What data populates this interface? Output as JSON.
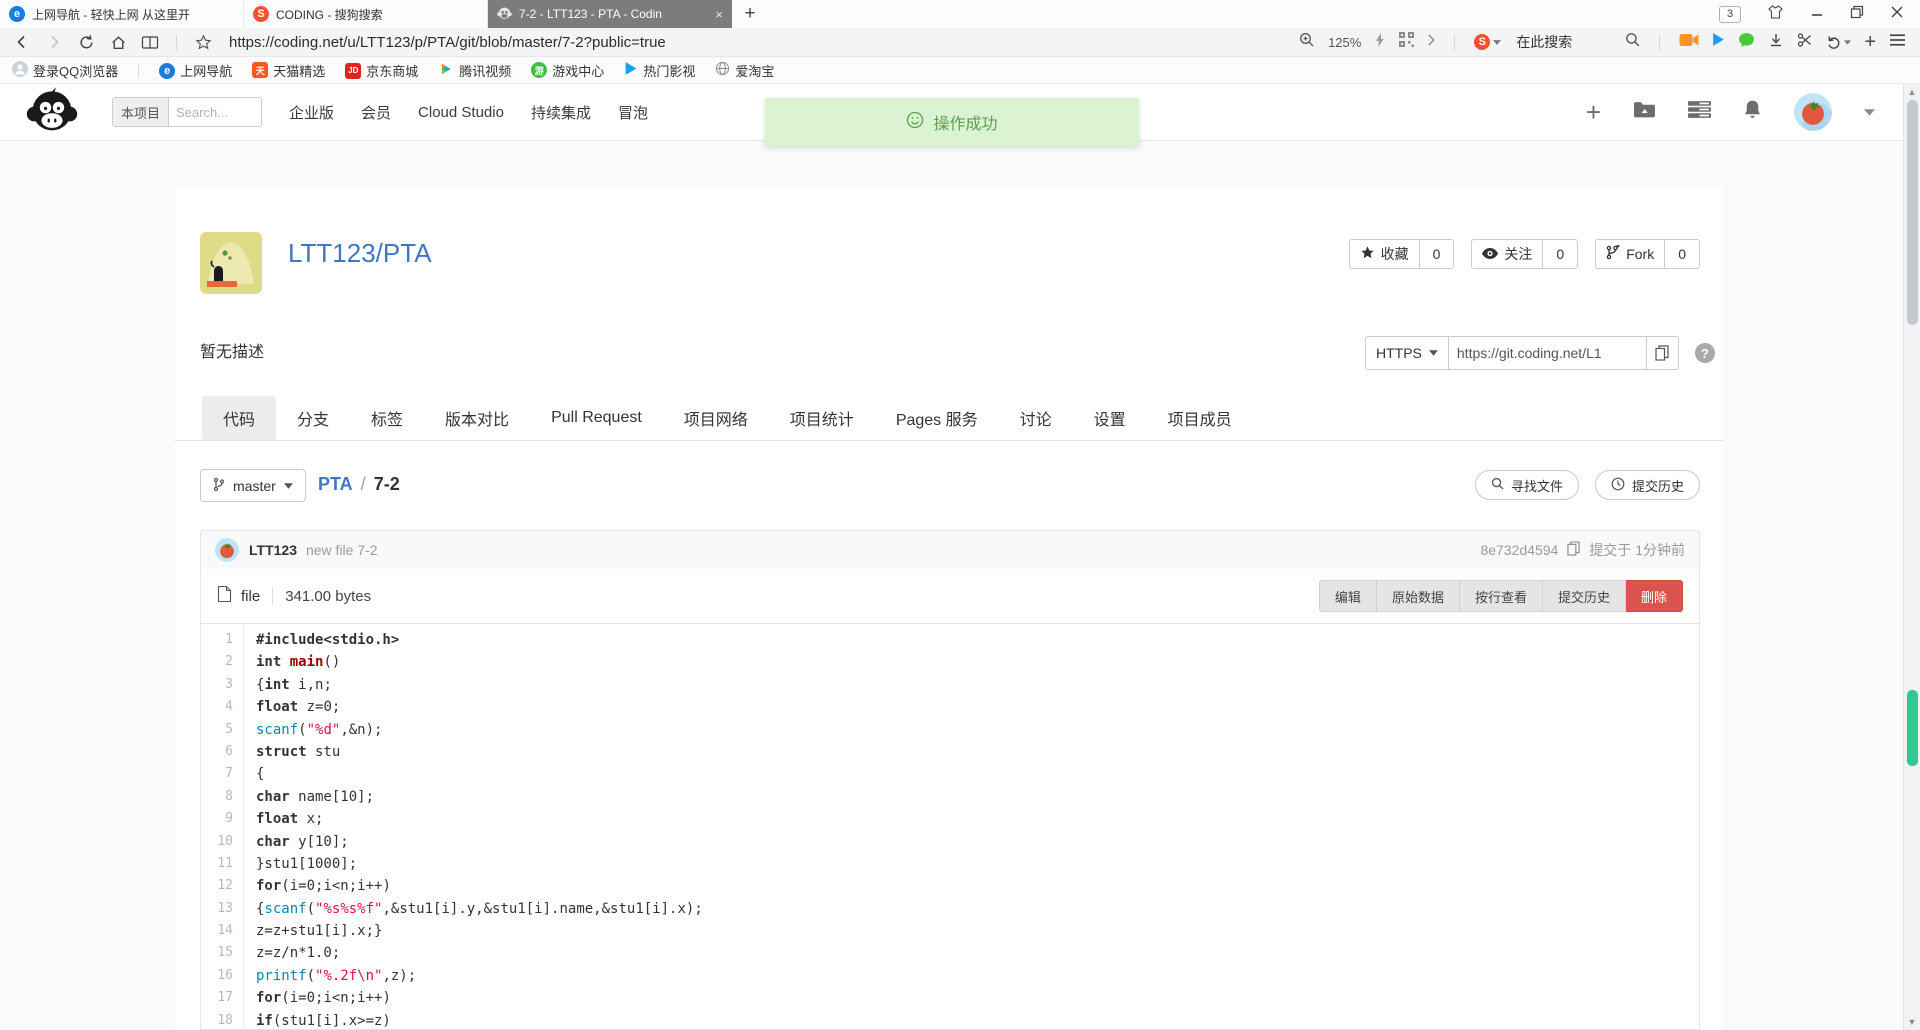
{
  "colors": {
    "accent": "#4078c0",
    "danger": "#d9534f",
    "toast_green": "#58a04e",
    "scroll_marker_green": "#2fc98f"
  },
  "browser": {
    "window": {
      "tab_count": "3"
    },
    "tabs": [
      {
        "title": "上网导航 - 轻快上网 从这里开",
        "icon": "nav-e-icon",
        "active": false
      },
      {
        "title": "CODING - 搜狗搜索",
        "icon": "sogou-icon",
        "active": false
      },
      {
        "title": "7-2 - LTT123 - PTA - Codin",
        "icon": "coding-monkey-icon",
        "active": true
      }
    ],
    "address": {
      "url": "https://coding.net/u/LTT123/p/PTA/git/blob/master/7-2?public=true",
      "zoom": "125%",
      "search_hint": "在此搜索"
    },
    "bookmarks": [
      {
        "label": "登录QQ浏览器",
        "icon": "user-icon"
      },
      {
        "label": "上网导航",
        "icon": "nav-e-icon"
      },
      {
        "label": "天猫精选",
        "icon": "tmall-icon"
      },
      {
        "label": "京东商城",
        "icon": "jd-icon"
      },
      {
        "label": "腾讯视频",
        "icon": "tencent-video-icon"
      },
      {
        "label": "游戏中心",
        "icon": "game-icon"
      },
      {
        "label": "热门影视",
        "icon": "hot-video-icon"
      },
      {
        "label": "爱淘宝",
        "icon": "globe-icon"
      }
    ]
  },
  "site_header": {
    "search_scope": "本项目",
    "search_placeholder": "Search...",
    "nav": [
      "企业版",
      "会员",
      "Cloud Studio",
      "持续集成",
      "冒泡"
    ],
    "toast_text": "操作成功"
  },
  "project": {
    "title": "LTT123/PTA",
    "description": "暂无描述",
    "stats": [
      {
        "label": "收藏",
        "count": "0",
        "icon": "star-icon"
      },
      {
        "label": "关注",
        "count": "0",
        "icon": "eye-icon"
      },
      {
        "label": "Fork",
        "count": "0",
        "icon": "fork-icon"
      }
    ],
    "clone": {
      "protocol": "HTTPS",
      "url": "https://git.coding.net/L1"
    }
  },
  "repo": {
    "tabs": [
      "代码",
      "分支",
      "标签",
      "版本对比",
      "Pull Request",
      "项目网络",
      "项目统计",
      "Pages 服务",
      "讨论",
      "设置",
      "项目成员"
    ],
    "active_tab": "代码",
    "branch": "master",
    "crumbs": [
      "PTA",
      "7-2"
    ],
    "find_file_label": "寻找文件",
    "commit_history_label": "提交历史"
  },
  "commit": {
    "author": "LTT123",
    "message": "new file 7-2",
    "hash": "8e732d4594",
    "time": "提交于 1分钟前"
  },
  "file": {
    "type_label": "file",
    "size": "341.00 bytes",
    "actions": [
      "编辑",
      "原始数据",
      "按行查看",
      "提交历史"
    ],
    "delete_label": "删除"
  },
  "code": {
    "lines": [
      {
        "n": 1,
        "segs": [
          {
            "c": "k",
            "t": "#include<stdio.h>"
          }
        ]
      },
      {
        "n": 2,
        "segs": [
          {
            "c": "k",
            "t": "int "
          },
          {
            "c": "m",
            "t": "main"
          },
          {
            "c": "p",
            "t": "()"
          }
        ]
      },
      {
        "n": 3,
        "segs": [
          {
            "c": "p",
            "t": "{"
          },
          {
            "c": "k",
            "t": "int"
          },
          {
            "c": "p",
            "t": " i,n;"
          }
        ]
      },
      {
        "n": 4,
        "segs": [
          {
            "c": "k",
            "t": "float"
          },
          {
            "c": "p",
            "t": " z=0;"
          }
        ]
      },
      {
        "n": 5,
        "segs": [
          {
            "c": "f",
            "t": "scanf"
          },
          {
            "c": "p",
            "t": "("
          },
          {
            "c": "s",
            "t": "\"%d\""
          },
          {
            "c": "p",
            "t": ",&n);"
          }
        ]
      },
      {
        "n": 6,
        "segs": [
          {
            "c": "k",
            "t": "struct"
          },
          {
            "c": "p",
            "t": " stu"
          }
        ]
      },
      {
        "n": 7,
        "segs": [
          {
            "c": "p",
            "t": "{"
          }
        ]
      },
      {
        "n": 8,
        "segs": [
          {
            "c": "k",
            "t": "char"
          },
          {
            "c": "p",
            "t": " name[10];"
          }
        ]
      },
      {
        "n": 9,
        "segs": [
          {
            "c": "k",
            "t": "float"
          },
          {
            "c": "p",
            "t": " x;"
          }
        ]
      },
      {
        "n": 10,
        "segs": [
          {
            "c": "k",
            "t": "char"
          },
          {
            "c": "p",
            "t": " y[10];"
          }
        ]
      },
      {
        "n": 11,
        "segs": [
          {
            "c": "p",
            "t": "}stu1[1000];"
          }
        ]
      },
      {
        "n": 12,
        "segs": [
          {
            "c": "k",
            "t": "for"
          },
          {
            "c": "p",
            "t": "(i=0;i<n;i++)"
          }
        ]
      },
      {
        "n": 13,
        "segs": [
          {
            "c": "p",
            "t": "{"
          },
          {
            "c": "f",
            "t": "scanf"
          },
          {
            "c": "p",
            "t": "("
          },
          {
            "c": "s",
            "t": "\"%s%s%f\""
          },
          {
            "c": "p",
            "t": ",&stu1[i].y,&stu1[i].name,&stu1[i].x);"
          }
        ]
      },
      {
        "n": 14,
        "segs": [
          {
            "c": "p",
            "t": "z=z+stu1[i].x;}"
          }
        ]
      },
      {
        "n": 15,
        "segs": [
          {
            "c": "p",
            "t": "z=z/n*1.0;"
          }
        ]
      },
      {
        "n": 16,
        "segs": [
          {
            "c": "f",
            "t": "printf"
          },
          {
            "c": "p",
            "t": "("
          },
          {
            "c": "s",
            "t": "\"%.2f\\n\""
          },
          {
            "c": "p",
            "t": ",z);"
          }
        ]
      },
      {
        "n": 17,
        "segs": [
          {
            "c": "k",
            "t": "for"
          },
          {
            "c": "p",
            "t": "(i=0;i<n;i++)"
          }
        ]
      },
      {
        "n": 18,
        "segs": [
          {
            "c": "k",
            "t": "if"
          },
          {
            "c": "p",
            "t": "(stu1[i].x>=z)"
          }
        ]
      }
    ]
  }
}
